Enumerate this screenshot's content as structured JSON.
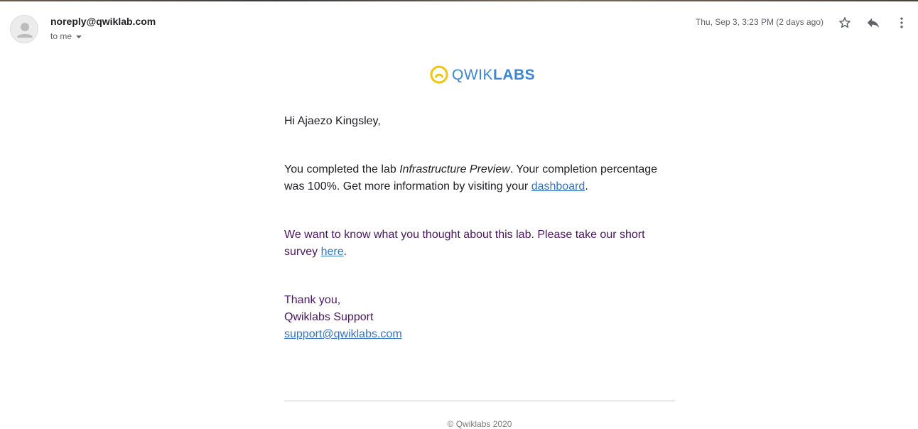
{
  "header": {
    "sender": "noreply@qwiklab.com",
    "recipient": "to me",
    "date": "Thu, Sep 3, 3:23 PM (2 days ago)",
    "icons": {
      "avatar": "person-icon",
      "star": "star-icon",
      "reply": "reply-icon",
      "more": "more-vert-icon"
    }
  },
  "logo": {
    "light": "QWIK",
    "bold": "LABS",
    "ring_color": "#f2c40f",
    "text_color": "#3a86d6"
  },
  "email": {
    "greeting": "Hi Ajaezo Kingsley,",
    "completed_prefix": "You completed the lab ",
    "lab_name": "Infrastructure Preview",
    "completed_middle": ". Your completion percentage was 100%. Get more information by visiting your ",
    "dashboard_link": "dashboard",
    "completed_suffix": ".",
    "survey_prefix": "We want to know what you thought about this lab. Please take our short survey ",
    "survey_link": "here",
    "survey_suffix": ".",
    "thanks": "Thank you,",
    "team": "Qwiklabs Support",
    "support_email": "support@qwiklabs.com"
  },
  "footer": {
    "copyright": "© Qwiklabs 2020"
  },
  "colors": {
    "link": "#3173c9",
    "purple_text": "#4a1560",
    "body_text": "#202124",
    "muted": "#5f6368"
  }
}
